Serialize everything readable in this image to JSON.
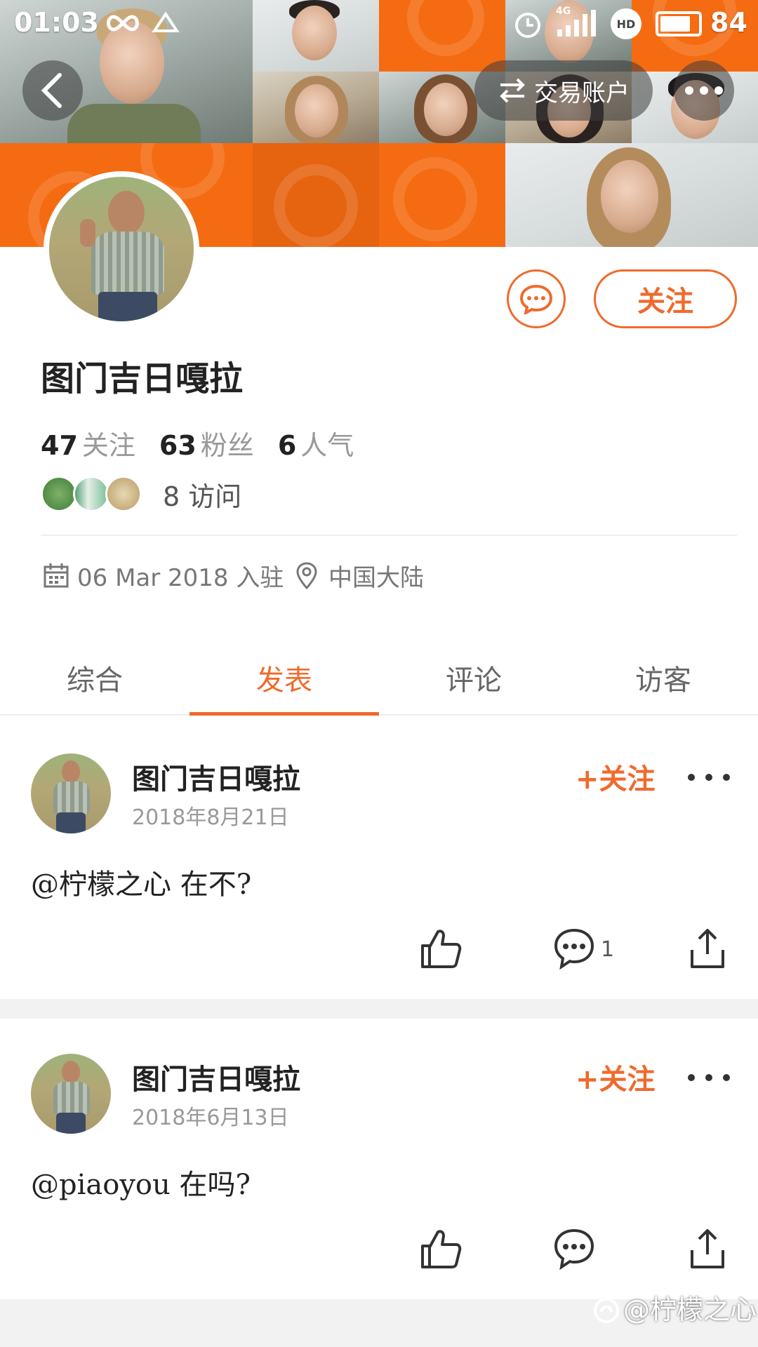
{
  "status_bar": {
    "time": "01:03",
    "battery": "84",
    "network": "4G",
    "hd_label": "HD",
    "icons": [
      "infinity-icon",
      "bird-icon",
      "alarm-icon",
      "signal-icon",
      "hd-icon",
      "battery-icon"
    ]
  },
  "header": {
    "back_icon": "back-arrow-icon",
    "trade_account_label": "交易账户",
    "trade_icon": "swap-arrows-icon",
    "more_icon": "more-dots-icon"
  },
  "profile": {
    "username": "图门吉日嘎拉",
    "follow_label": "关注",
    "message_icon": "chat-bubble-icon",
    "stats": [
      {
        "num": "47",
        "label": "关注"
      },
      {
        "num": "63",
        "label": "粉丝"
      },
      {
        "num": "6",
        "label": "人气"
      }
    ],
    "visits": "8 访问",
    "joined": "06 Mar 2018 入驻",
    "location": "中国大陆"
  },
  "tabs": [
    {
      "label": "综合"
    },
    {
      "label": "发表"
    },
    {
      "label": "评论"
    },
    {
      "label": "访客"
    }
  ],
  "active_tab": "发表",
  "posts": [
    {
      "author": "图门吉日嘎拉",
      "date": "2018年8月21日",
      "follow": "+关注",
      "content": "@柠檬之心 在不?",
      "comment_count": "1"
    },
    {
      "author": "图门吉日嘎拉",
      "date": "2018年6月13日",
      "follow": "+关注",
      "content": "@piaoyou 在吗?"
    }
  ],
  "watermark": "@柠檬之心",
  "colors": {
    "accent": "#f06a2c",
    "header_orange": "#f56b12",
    "separator": "#f2f2f2"
  }
}
